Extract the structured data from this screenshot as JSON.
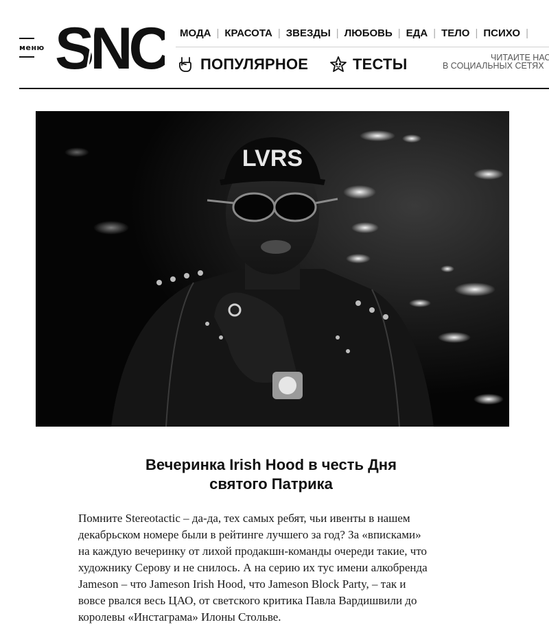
{
  "header": {
    "menu_label": "меню",
    "logo_text": "SNC",
    "nav_top": [
      "МОДА",
      "КРАСОТА",
      "ЗВЕЗДЫ",
      "ЛЮБОВЬ",
      "ЕДА",
      "ТЕЛО",
      "ПСИХО"
    ],
    "nav_popular": "ПОПУЛЯРНОЕ",
    "nav_tests": "ТЕСТЫ",
    "social_line1": "ЧИТАЙТЕ НАС",
    "social_line2": "В СОЦИАЛЬНЫХ СЕТЯХ",
    "icons": {
      "popular": "rock-hand-icon",
      "tests": "smiling-star-icon"
    }
  },
  "photo": {
    "cap_text": "LVRS"
  },
  "article": {
    "title_lines": [
      "Вечеринка Irish Hood в честь Дня",
      "святого Патрика"
    ],
    "body_lines": [
      "Помните Stereotactic – да-да, тех самых ребят, чьи ивенты в нашем",
      "декабрьском номере были в рейтинге лучшего за год?  За «вписками»",
      "на каждую вечеринку от лихой продакшн-команды очереди такие, что",
      "художнику Серову и не снилось. А на серию их тус имени алкобренда",
      "Jameson – что Jameson Irish Hood, что Jameson Block Party, –  так и",
      "вовсе рвался весь ЦАО, от светского критика Павла Вардишвили до",
      "королевы «Инстаграма» Илоны Стольве."
    ]
  },
  "colors": {
    "text": "#111111",
    "rule": "#111111",
    "separator": "#aaaaaa"
  }
}
